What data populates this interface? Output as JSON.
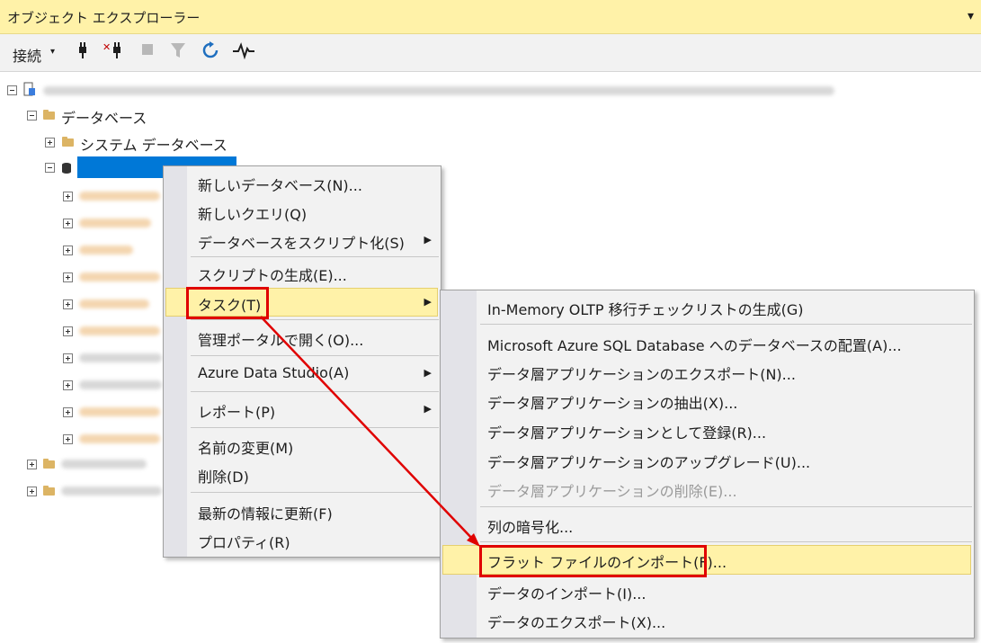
{
  "title": "オブジェクト エクスプローラー",
  "title_dropdown": "▾",
  "toolbar": {
    "connect_label": "接続",
    "connect_caret": "▾",
    "icons": [
      "connect-plug-icon",
      "disconnect-icon",
      "stop-icon",
      "filter-icon",
      "refresh-icon",
      "activity-monitor-icon"
    ],
    "glyphs": {
      "connect": "🔌",
      "disconnect": "✕",
      "stop": "■",
      "filter": "▼",
      "refresh": "⟳",
      "activity": "∿"
    }
  },
  "tree": {
    "databases": "データベース",
    "system_databases": "システム データベース"
  },
  "context_menu": {
    "items": [
      "新しいデータベース(N)...",
      "新しいクエリ(Q)",
      "データベースをスクリプト化(S)",
      "スクリプトの生成(E)...",
      "タスク(T)",
      "管理ポータルで開く(O)...",
      "Azure Data Studio(A)",
      "レポート(P)",
      "名前の変更(M)",
      "削除(D)",
      "最新の情報に更新(F)",
      "プロパティ(R)"
    ],
    "arrow": "▶"
  },
  "submenu": {
    "items": [
      "In-Memory OLTP 移行チェックリストの生成(G)",
      "Microsoft Azure SQL Database へのデータベースの配置(A)...",
      "データ層アプリケーションのエクスポート(N)...",
      "データ層アプリケーションの抽出(X)...",
      "データ層アプリケーションとして登録(R)...",
      "データ層アプリケーションのアップグレード(U)...",
      "データ層アプリケーションの削除(E)...",
      "列の暗号化...",
      "フラット ファイルのインポート(F)...",
      "データのインポート(I)...",
      "データのエクスポート(X)..."
    ]
  },
  "colors": {
    "title_bg": "#fff2a8",
    "highlight": "#fff2a8",
    "annotation_red": "#e00000",
    "selection": "#0078d7"
  }
}
